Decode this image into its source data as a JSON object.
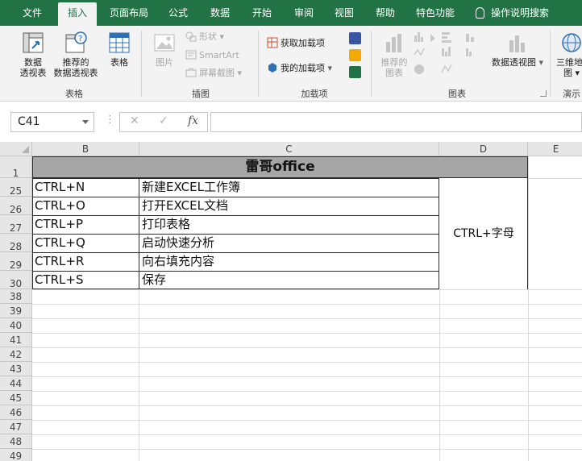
{
  "tabs": [
    {
      "label": "文件",
      "active": false
    },
    {
      "label": "插入",
      "active": true
    },
    {
      "label": "页面布局",
      "active": false
    },
    {
      "label": "公式",
      "active": false
    },
    {
      "label": "数据",
      "active": false
    },
    {
      "label": "开始",
      "active": false
    },
    {
      "label": "审阅",
      "active": false
    },
    {
      "label": "视图",
      "active": false
    },
    {
      "label": "帮助",
      "active": false
    },
    {
      "label": "特色功能",
      "active": false
    }
  ],
  "tell_me": "操作说明搜索",
  "ribbon": {
    "groups": {
      "tables": "表格",
      "illustrations": "插图",
      "addins": "加载项",
      "charts": "图表",
      "tours": "演示"
    },
    "pivot_line1": "数据",
    "pivot_line2": "透视表",
    "rec_pivot_line1": "推荐的",
    "rec_pivot_line2": "数据透视表",
    "table": "表格",
    "pictures": "图片",
    "shapes": "形状",
    "smartart": "SmartArt",
    "screenshot": "屏幕截图",
    "get_addins": "获取加载项",
    "my_addins": "我的加载项",
    "rec_charts_line1": "推荐的",
    "rec_charts_line2": "图表",
    "pivot_chart": "数据透视图",
    "map3d_line1": "三维地",
    "map3d_line2": "图"
  },
  "formula_bar": {
    "name_box": "C41",
    "formula": ""
  },
  "colors": {
    "accent": "#217346",
    "title_fill": "#a6a6a6"
  },
  "grid": {
    "columns": [
      "B",
      "C",
      "D",
      "E"
    ],
    "rows": [
      "1",
      "25",
      "26",
      "27",
      "28",
      "29",
      "30",
      "38",
      "39",
      "40",
      "41",
      "42",
      "43",
      "44",
      "45",
      "46",
      "47",
      "48",
      "49"
    ],
    "title": "雷哥office",
    "table": [
      {
        "key": "CTRL+N",
        "desc": "新建EXCEL工作簿"
      },
      {
        "key": "CTRL+O",
        "desc": "打开EXCEL文档"
      },
      {
        "key": "CTRL+P",
        "desc": "打印表格"
      },
      {
        "key": "CTRL+Q",
        "desc": "启动快速分析"
      },
      {
        "key": "CTRL+R",
        "desc": "向右填充内容"
      },
      {
        "key": "CTRL+S",
        "desc": "保存"
      }
    ],
    "merged_label": "CTRL+字母"
  }
}
